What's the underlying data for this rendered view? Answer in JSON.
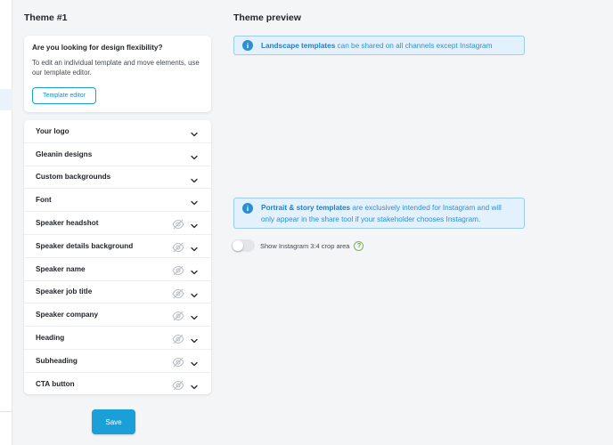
{
  "left": {
    "theme_title": "Theme #1",
    "flex_card": {
      "question": "Are you looking for design flexibility?",
      "description": "To edit an individual template and move elements, use our template editor.",
      "button_label": "Template editor"
    },
    "settings": [
      {
        "label": "Your logo",
        "visibility_toggle": false,
        "icon": "chevron-down-icon"
      },
      {
        "label": "Gleanin designs",
        "visibility_toggle": false,
        "icon": "chevron-down-icon"
      },
      {
        "label": "Custom backgrounds",
        "visibility_toggle": false,
        "icon": "chevron-down-icon"
      },
      {
        "label": "Font",
        "visibility_toggle": false,
        "icon": "chevron-down-icon"
      },
      {
        "label": "Speaker headshot",
        "visibility_toggle": true,
        "icon": "eye-off-icon"
      },
      {
        "label": "Speaker details background",
        "visibility_toggle": true,
        "icon": "eye-off-icon"
      },
      {
        "label": "Speaker name",
        "visibility_toggle": true,
        "icon": "eye-off-icon"
      },
      {
        "label": "Speaker job title",
        "visibility_toggle": true,
        "icon": "eye-off-icon"
      },
      {
        "label": "Speaker company",
        "visibility_toggle": true,
        "icon": "eye-off-icon"
      },
      {
        "label": "Heading",
        "visibility_toggle": true,
        "icon": "eye-off-icon"
      },
      {
        "label": "Subheading",
        "visibility_toggle": true,
        "icon": "eye-off-icon"
      },
      {
        "label": "CTA button",
        "visibility_toggle": true,
        "icon": "eye-off-icon"
      }
    ],
    "save_label": "Save"
  },
  "preview": {
    "title": "Theme preview",
    "landscape_info": {
      "bold": "Landscape templates",
      "rest": " can be shared on all channels except Instagram"
    },
    "portrait_info": {
      "bold": "Portrait & story templates",
      "rest": " are exclusively intended for Instagram and will only appear in the share tool if your stakeholder chooses Instagram."
    },
    "crop_toggle_label": "Show Instagram 3:4 crop area",
    "crop_toggle_on": false,
    "help_glyph": "?",
    "info_glyph": "i"
  },
  "colors": {
    "accent": "#1a9fd6",
    "info_bg": "#e3f1fc",
    "info_text": "#2b8fd4"
  }
}
